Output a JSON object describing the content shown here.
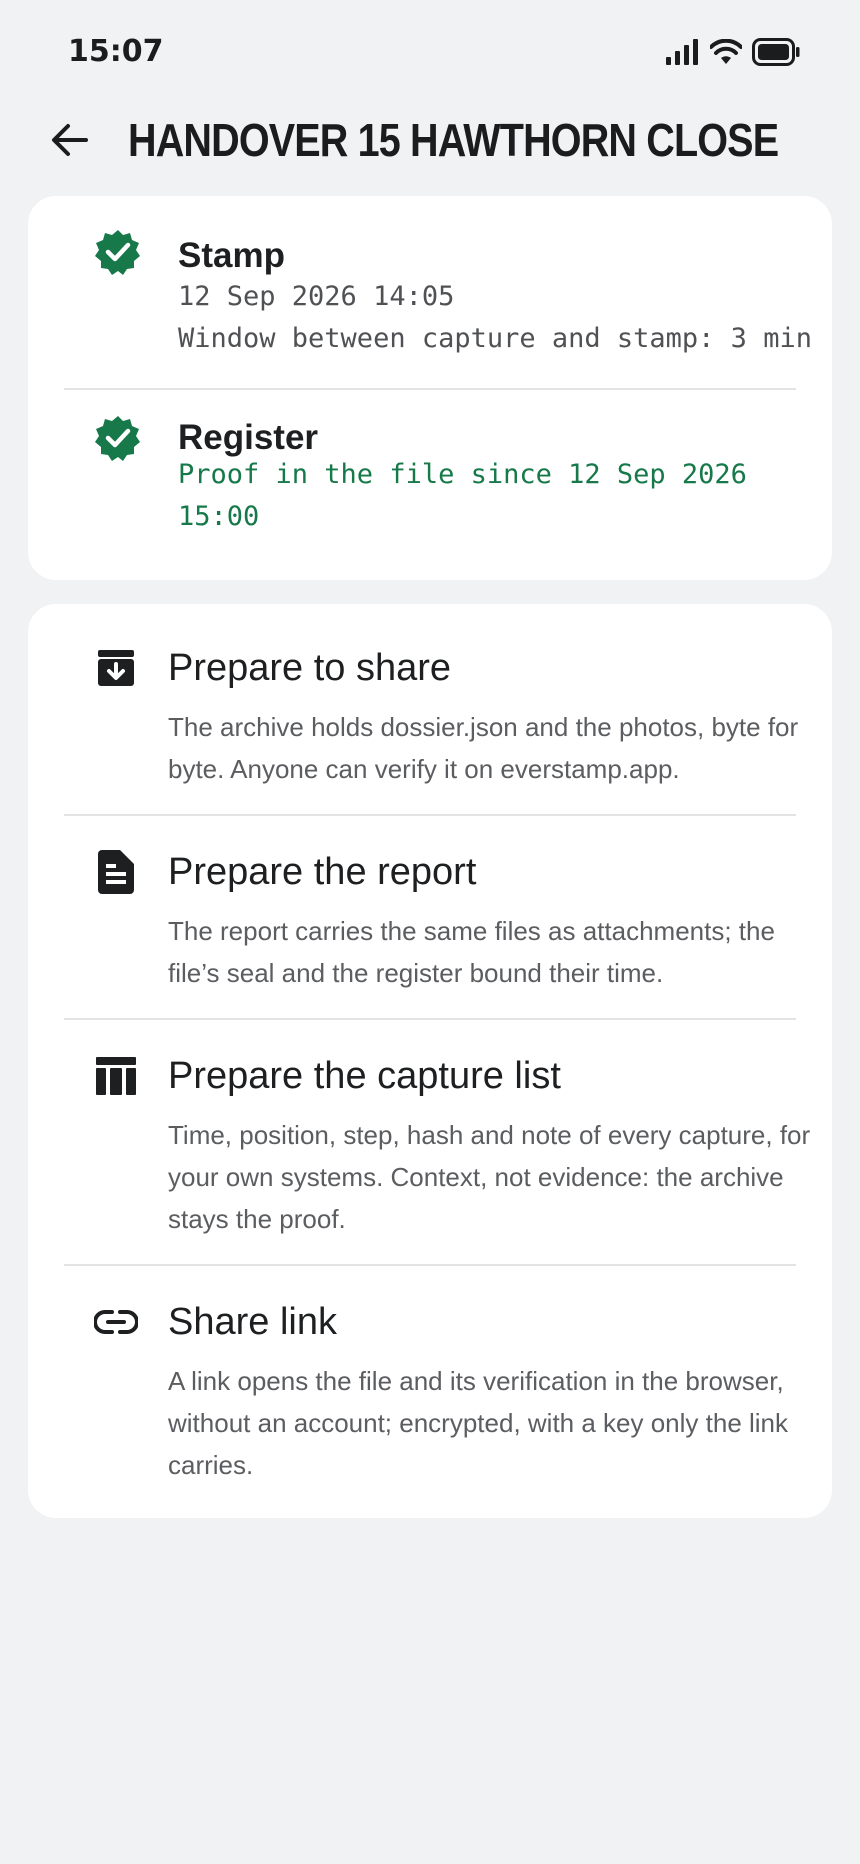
{
  "status_bar": {
    "time": "15:07"
  },
  "header": {
    "title": "HANDOVER 15 HAWTHORN CLOSE"
  },
  "checks": [
    {
      "title": "Stamp",
      "lines": [
        "12 Sep 2026 14:05",
        "Window between capture and stamp: 3 min"
      ]
    },
    {
      "title": "Register",
      "lines": [
        "Proof in the file since 12 Sep 2026\n15:00"
      ]
    }
  ],
  "colors": {
    "accent_green": "#17794a",
    "background": "#f1f2f4"
  },
  "actions": [
    {
      "icon": "archive-download-icon",
      "title": "Prepare to share",
      "description": "The archive holds dossier.json and the photos, byte for byte. Anyone can verify it on everstamp.app."
    },
    {
      "icon": "document-icon",
      "title": "Prepare the report",
      "description": "The report carries the same files as attachments; the file’s seal and the register bound their time."
    },
    {
      "icon": "table-columns-icon",
      "title": "Prepare the capture list",
      "description": "Time, position, step, hash and note of every capture, for your own systems. Context, not evidence: the archive stays the proof."
    },
    {
      "icon": "link-icon",
      "title": "Share link",
      "description": "A link opens the file and its verification in the browser, without an account; encrypted, with a key only the link carries."
    }
  ]
}
